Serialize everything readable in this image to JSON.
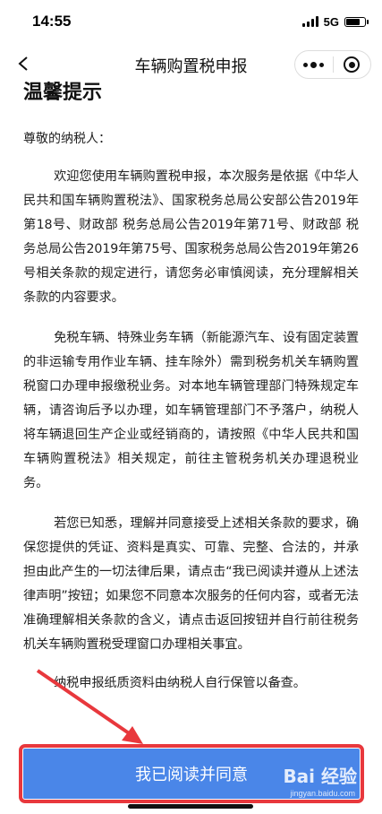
{
  "status_bar": {
    "time": "14:55",
    "network": "5G",
    "signal_icon": "signal-bars-icon",
    "battery_icon": "battery-icon"
  },
  "nav": {
    "title": "车辆购置税申报",
    "back_icon": "chevron-left-icon",
    "more_icon": "more-dots-icon",
    "close_icon": "target-circle-icon"
  },
  "notice": {
    "heading": "温馨提示",
    "greeting": "尊敬的纳税人：",
    "paragraphs": [
      "欢迎您使用车辆购置税申报，本次服务是依据《中华人民共和国车辆购置税法》、国家税务总局公安部公告2019年第18号、财政部 税务总局公告2019年第71号、财政部 税务总局公告2019年第75号、国家税务总局公告2019年第26号相关条款的规定进行，请您务必审慎阅读，充分理解相关条款的内容要求。",
      "免税车辆、特殊业务车辆（新能源汽车、设有固定装置的非运输专用作业车辆、挂车除外）需到税务机关车辆购置税窗口办理申报缴税业务。对本地车辆管理部门特殊规定车辆，请咨询后予以办理，如车辆管理部门不予落户，纳税人将车辆退回生产企业或经销商的，请按照《中华人民共和国车辆购置税法》相关规定，前往主管税务机关办理退税业务。",
      "若您已知悉，理解并同意接受上述相关条款的要求，确保您提供的凭证、资料是真实、可靠、完整、合法的，并承担由此产生的一切法律后果，请点击“我已阅读并遵从上述法律声明”按钮；如果您不同意本次服务的任何内容，或者无法准确理解相关条款的含义，请点击返回按钮并自行前往税务机关车辆购置税受理窗口办理相关事宜。",
      "纳税申报纸质资料由纳税人自行保管以备查。"
    ]
  },
  "footer": {
    "agree_label": "我已阅读并同意"
  },
  "watermark": {
    "brand": "Bai 经验",
    "url": "jingyan.baidu.com"
  },
  "colors": {
    "button": "#4a86e8",
    "highlight": "#e8383d"
  }
}
